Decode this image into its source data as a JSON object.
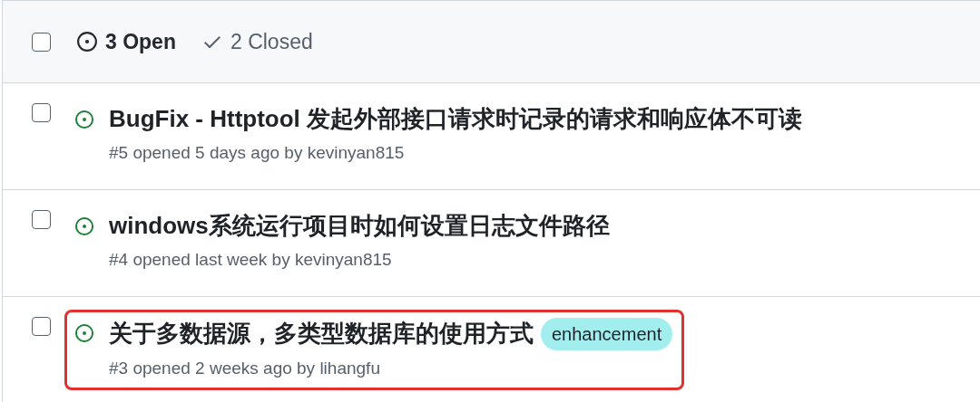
{
  "header": {
    "checked": false,
    "open_count": "3 Open",
    "closed_count": "2 Closed"
  },
  "issues": [
    {
      "checked": false,
      "title": "BugFix - Httptool 发起外部接口请求时记录的请求和响应体不可读",
      "meta": "#5 opened 5 days ago by kevinyan815",
      "highlighted": false
    },
    {
      "checked": false,
      "title": "windows系统运行项目时如何设置日志文件路径",
      "meta": "#4 opened last week by kevinyan815",
      "highlighted": false
    },
    {
      "checked": false,
      "title": "关于多数据源，多类型数据库的使用方式",
      "labels": [
        {
          "text": "enhancement",
          "color": "#a2eeef"
        }
      ],
      "meta": "#3 opened 2 weeks ago by lihangfu",
      "highlighted": true
    }
  ]
}
